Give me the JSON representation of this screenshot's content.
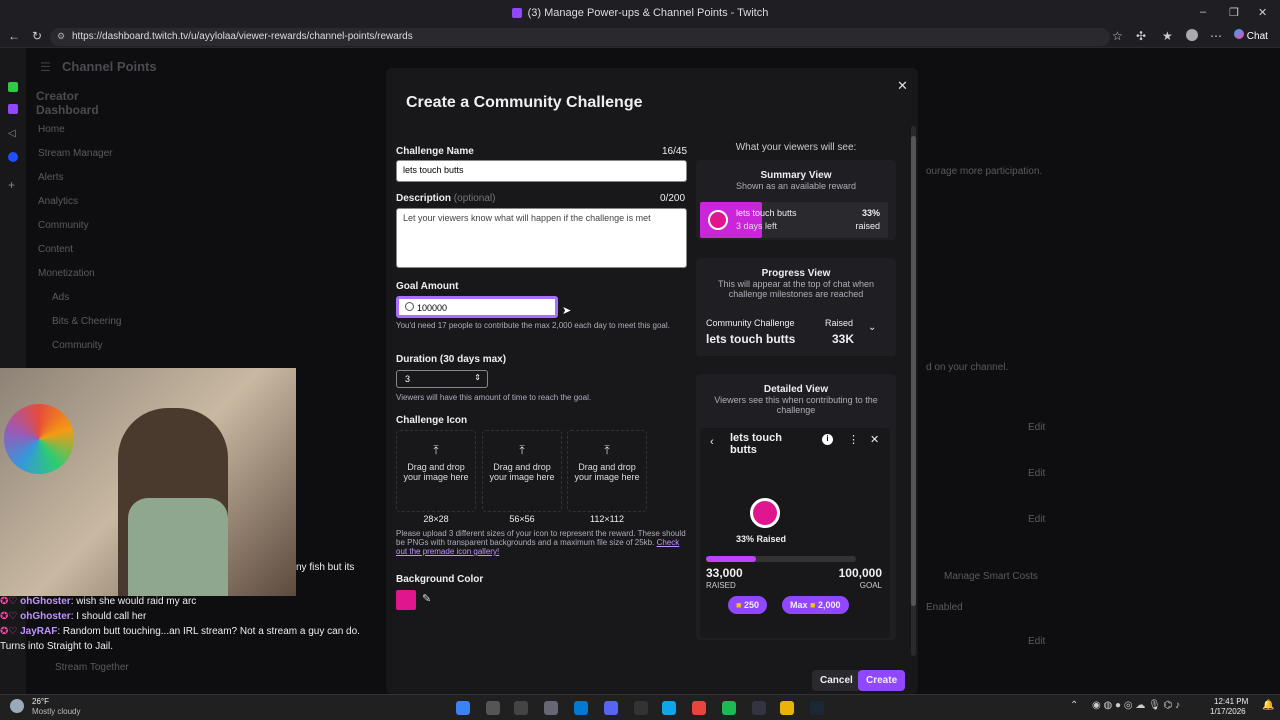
{
  "browser": {
    "title": "(3) Manage Power-ups & Channel Points - Twitch",
    "url": "https://dashboard.twitch.tv/u/ayylolaa/viewer-rewards/channel-points/rewards",
    "chat_label": "Chat"
  },
  "dashboard": {
    "header": "Channel Points",
    "side_title": "Creator Dashboard",
    "nav": [
      "Home",
      "Stream Manager",
      "Alerts",
      "Analytics",
      "Community",
      "Content",
      "Monetization",
      "Ads",
      "Bits & Cheering",
      "Community",
      "Stream Together"
    ],
    "bg_text_1": "ourage more participation.",
    "bg_text_2": "d on your channel.",
    "edit": "Edit",
    "manage_smart": "Manage Smart Costs",
    "enabled": "Enabled"
  },
  "modal": {
    "title": "Create a Community Challenge",
    "name_label": "Challenge Name",
    "name_count": "16/45",
    "name_value": "lets touch butts",
    "desc_label": "Description",
    "desc_optional": "(optional)",
    "desc_count": "0/200",
    "desc_placeholder": "Let your viewers know what will happen if the challenge is met",
    "goal_label": "Goal Amount",
    "goal_value": "100000",
    "goal_note": "You'd need 17 people to contribute the max 2,000 each day to meet this goal.",
    "duration_label": "Duration (30 days max)",
    "duration_value": "3",
    "duration_note": "Viewers will have this amount of time to reach the goal.",
    "icon_label": "Challenge Icon",
    "upload_text": "Drag and drop your image here",
    "sizes": [
      "28×28",
      "56×56",
      "112×112"
    ],
    "icon_note": "Please upload 3 different sizes of your icon to represent the reward. These should be PNGs with transparent backgrounds and a maximum file size of 25kb.",
    "icon_link": "Check out the premade icon gallery!",
    "bg_color_label": "Background Color",
    "bg_color": "#e0168f",
    "cancel": "Cancel",
    "create": "Create"
  },
  "preview": {
    "heading": "What your viewers will see:",
    "summary_title": "Summary View",
    "summary_sub": "Shown as an available reward",
    "summary_name": "lets touch butts",
    "summary_time": "3 days left",
    "summary_pct": "33%",
    "summary_raised": "raised",
    "summary_progress": 0.33,
    "progress_title": "Progress View",
    "progress_sub": "This will appear at the top of chat when challenge milestones are reached",
    "progress_label": "Community Challenge",
    "progress_name": "lets touch butts",
    "progress_raised_label": "Raised",
    "progress_raised": "33K",
    "detailed_title": "Detailed View",
    "detailed_sub": "Viewers see this when contributing to the challenge",
    "detailed_name": "lets touch butts",
    "detailed_pct": "33% Raised",
    "detailed_progress": 0.33,
    "raised_value": "33,000",
    "raised_label": "RAISED",
    "goal_value": "100,000",
    "goal_label": "GOAL",
    "btn1": "250",
    "btn2_prefix": "Max",
    "btn2": "2,000"
  },
  "chat": {
    "partial": "ny fish but its",
    "messages": [
      {
        "user": "ohGhoster",
        "text": ": wish she would raid my arc"
      },
      {
        "user": "ohGhoster",
        "text": ": I should call her"
      },
      {
        "user": "JayRAF",
        "text": ": Random butt touching...an IRL stream? Not a stream a guy can do. Turns into Straight to Jail."
      }
    ]
  },
  "taskbar": {
    "weather_temp": "26°F",
    "weather_desc": "Mostly cloudy",
    "time": "12:41 PM",
    "date": "1/17/2026"
  }
}
